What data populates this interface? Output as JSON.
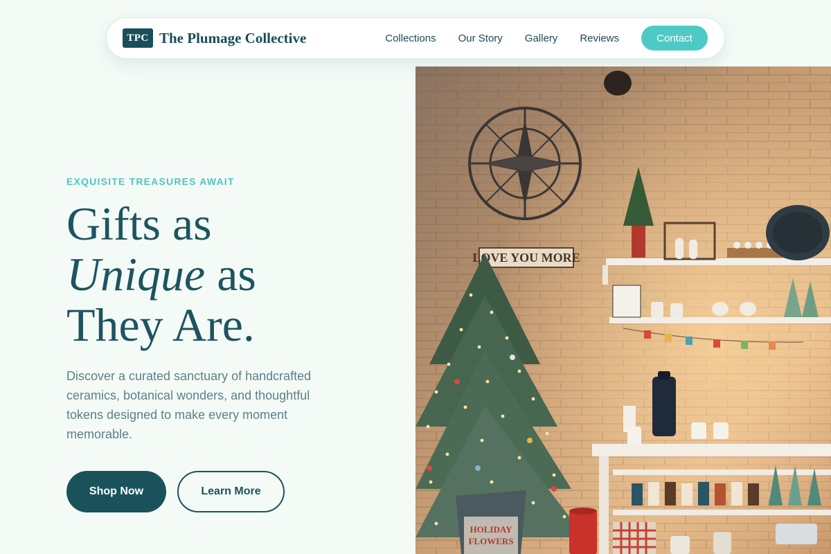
{
  "nav": {
    "logo_badge": "TPC",
    "brand": "The Plumage Collective",
    "links": [
      "Collections",
      "Our Story",
      "Gallery",
      "Reviews"
    ],
    "contact_label": "Contact"
  },
  "hero": {
    "eyebrow": "EXQUISITE TREASURES AWAIT",
    "headline_line1": "Gifts as",
    "headline_italic": "Unique",
    "headline_line2_rest": " as",
    "headline_line3": "They Are.",
    "lead": "Discover a curated sanctuary of handcrafted ceramics, botanical wonders, and thoughtful tokens designed to make every moment memorable.",
    "primary_button": "Shop Now",
    "secondary_button": "Learn More"
  },
  "image": {
    "sign_text": "LOVE YOU MORE",
    "bucket_text_1": "HOLIDAY",
    "bucket_text_2": "FLOWERS"
  },
  "colors": {
    "background": "#f4fbf7",
    "primary": "#1a525c",
    "accent": "#4fc9c4",
    "text_muted": "#5c7f86"
  }
}
